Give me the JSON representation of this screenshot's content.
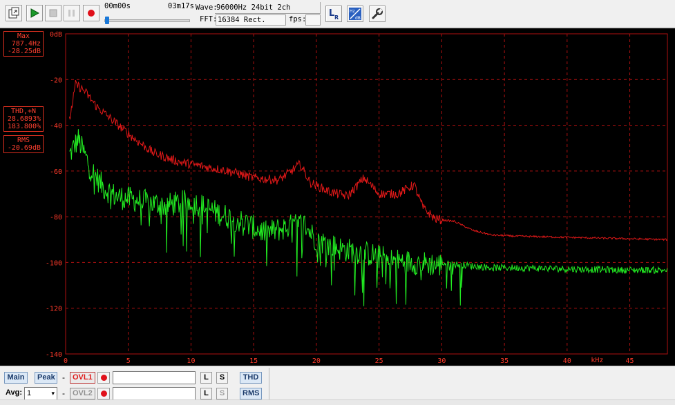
{
  "toolbar": {
    "time_start": "00m00s",
    "time_end": "03m17s",
    "wave_label": "Wave:",
    "wave_value": "96000Hz 24bit 2ch",
    "fft_label": "FFT:",
    "fft_value": "16384 Rect.",
    "fps_label": "fps:",
    "fps_value": "",
    "progress": 0.0
  },
  "info": {
    "max_title": "Max",
    "max_freq": "787.4Hz",
    "max_level": "-28.25dB",
    "thd_title": "THD,+N",
    "thd_value": "28.6893%",
    "thdn_value": "183.800%",
    "rms_title": "RMS",
    "rms_value": "-20.69dB"
  },
  "controls": {
    "main_label": "Main",
    "peak_label": "Peak",
    "avg_label": "Avg:",
    "avg_value": "1",
    "ovl1_label": "OVL1",
    "ovl2_label": "OVL2",
    "dash": "-",
    "l_label": "L",
    "s_label": "S",
    "thd_label": "THD",
    "rms_label": "RMS"
  },
  "colors": {
    "red_series": "#e01818",
    "green_series": "#22ee22",
    "grid": "#b01010",
    "axis_text": "#ff3a2a"
  },
  "chart_data": {
    "type": "line",
    "x_unit": "kHz",
    "xlim": [
      0,
      48
    ],
    "x_ticks": [
      0,
      5,
      10,
      15,
      20,
      25,
      30,
      35,
      40,
      45
    ],
    "y_ticks": [
      "0dB",
      "-20",
      "-40",
      "-60",
      "-80",
      "-100",
      "-120",
      "-140"
    ],
    "ylim": [
      -140,
      0
    ],
    "series": [
      {
        "color": "red",
        "x": [
          0.3,
          0.8,
          1.5,
          2.5,
          4,
          5.5,
          7,
          9,
          11,
          13,
          15,
          17,
          18,
          18.7,
          19.5,
          21,
          22.5,
          23.8,
          25,
          26.5,
          27.8,
          28.5,
          29.5,
          31,
          32.5,
          34,
          36,
          40,
          44,
          48
        ],
        "y": [
          -38,
          -22,
          -25,
          -32,
          -39,
          -46,
          -52,
          -56,
          -58,
          -60,
          -63,
          -64,
          -60,
          -57,
          -65,
          -69,
          -71,
          -63,
          -70,
          -70,
          -66,
          -76,
          -81,
          -82,
          -86,
          -88,
          -88.5,
          -89,
          -89.5,
          -90
        ]
      },
      {
        "color": "green",
        "x": [
          0.3,
          1,
          2,
          3,
          4,
          6,
          8,
          10,
          12,
          14,
          16,
          18,
          19,
          20,
          22,
          24,
          26,
          28,
          30,
          32,
          34,
          36,
          40,
          44,
          48
        ],
        "y": [
          -52,
          -45,
          -58,
          -66,
          -70,
          -72,
          -74,
          -72,
          -77,
          -81,
          -86,
          -83,
          -82,
          -89,
          -93,
          -95,
          -98,
          -99,
          -100,
          -101,
          -102,
          -102,
          -102.5,
          -103,
          -103
        ]
      }
    ]
  }
}
